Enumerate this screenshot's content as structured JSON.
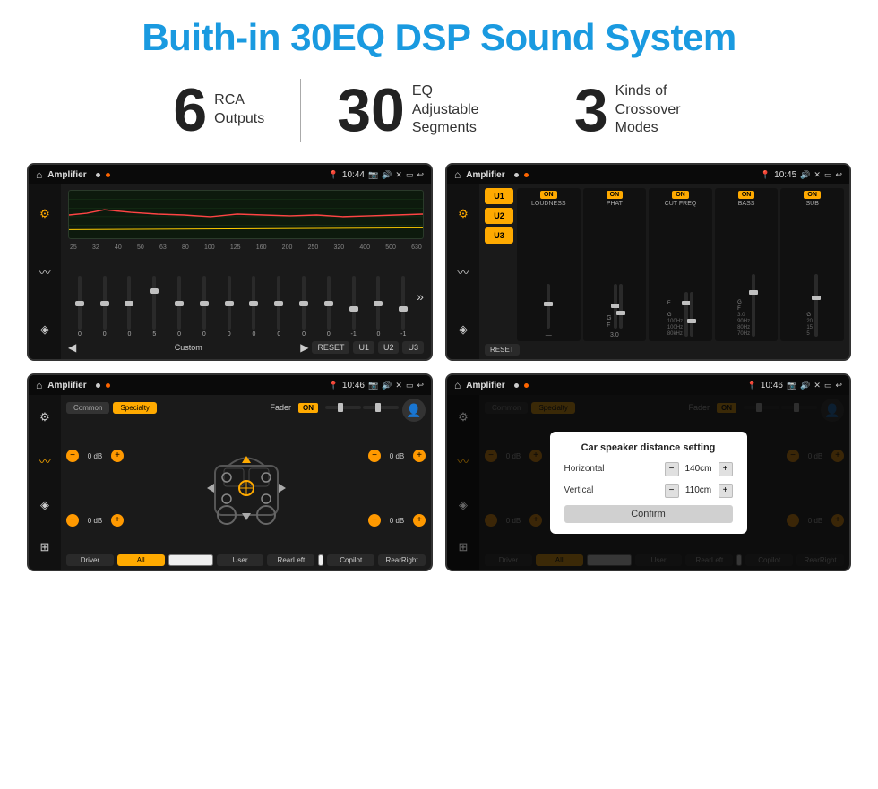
{
  "header": {
    "title": "Buith-in 30EQ DSP Sound System"
  },
  "stats": [
    {
      "number": "6",
      "label": "RCA\nOutputs"
    },
    {
      "number": "30",
      "label": "EQ Adjustable\nSegments"
    },
    {
      "number": "3",
      "label": "Kinds of\nCrossover Modes"
    }
  ],
  "screens": [
    {
      "id": "eq-screen",
      "statusBar": {
        "title": "Amplifier",
        "time": "10:44"
      }
    },
    {
      "id": "crossover-screen",
      "statusBar": {
        "title": "Amplifier",
        "time": "10:45"
      }
    },
    {
      "id": "fader-screen",
      "statusBar": {
        "title": "Amplifier",
        "time": "10:46"
      }
    },
    {
      "id": "dialog-screen",
      "statusBar": {
        "title": "Amplifier",
        "time": "10:46"
      },
      "dialog": {
        "title": "Car speaker distance setting",
        "horizontal": {
          "label": "Horizontal",
          "value": "140cm"
        },
        "vertical": {
          "label": "Vertical",
          "value": "110cm"
        },
        "confirm": "Confirm"
      }
    }
  ],
  "eq": {
    "frequencies": [
      "25",
      "32",
      "40",
      "50",
      "63",
      "80",
      "100",
      "125",
      "160",
      "200",
      "250",
      "320",
      "400",
      "500",
      "630"
    ],
    "values": [
      "0",
      "0",
      "0",
      "5",
      "0",
      "0",
      "0",
      "0",
      "0",
      "0",
      "0",
      "-1",
      "0",
      "-1"
    ],
    "presets": [
      "Custom",
      "RESET",
      "U1",
      "U2",
      "U3"
    ]
  },
  "crossover": {
    "uButtons": [
      "U1",
      "U2",
      "U3"
    ],
    "channels": [
      {
        "toggle": "ON",
        "name": "LOUDNESS"
      },
      {
        "toggle": "ON",
        "name": "PHAT"
      },
      {
        "toggle": "ON",
        "name": "CUT FREQ"
      },
      {
        "toggle": "ON",
        "name": "BASS"
      },
      {
        "toggle": "ON",
        "name": "SUB"
      }
    ],
    "reset": "RESET"
  },
  "fader": {
    "tabs": [
      "Common",
      "Specialty"
    ],
    "activeTab": "Specialty",
    "faderLabel": "Fader",
    "faderOn": "ON",
    "dbValues": [
      "0 dB",
      "0 dB",
      "0 dB",
      "0 dB"
    ],
    "buttons": [
      "Driver",
      "All",
      "User",
      "RearLeft",
      "Copilot",
      "RearRight"
    ]
  }
}
